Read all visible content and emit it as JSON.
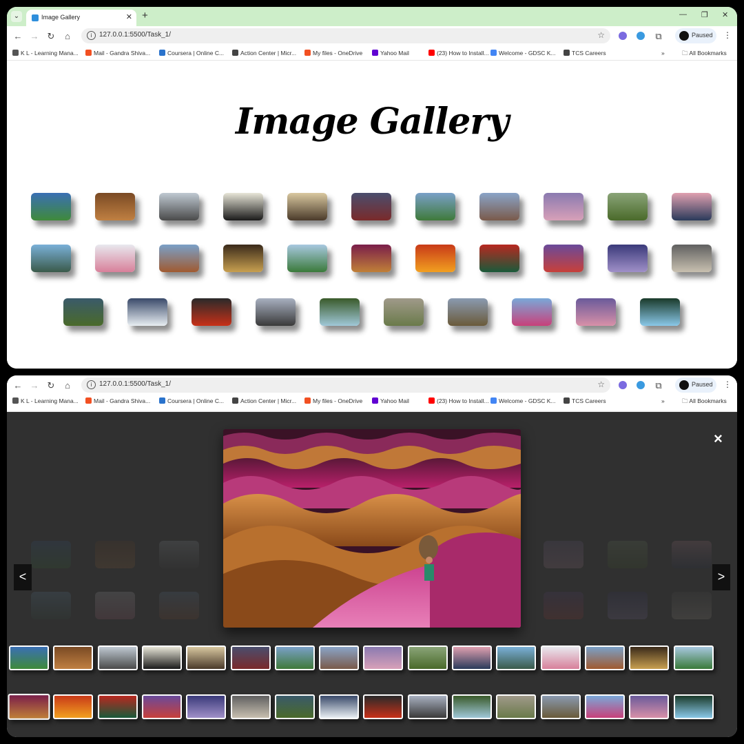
{
  "browser": {
    "tab_title": "Image Gallery",
    "url": "127.0.0.1:5500/Task_1/",
    "profile_label": "Paused",
    "all_bookmarks_label": "All Bookmarks",
    "overflow_label": "»"
  },
  "bookmarks": [
    {
      "label": "K L - Learning Mana...",
      "icon_color": "#555555"
    },
    {
      "label": "Mail - Gandra Shiva...",
      "icon_color": "#f25022"
    },
    {
      "label": "Coursera | Online C...",
      "icon_color": "#2a73cc"
    },
    {
      "label": "Action Center | Micr...",
      "icon_color": "#444444"
    },
    {
      "label": "My files - OneDrive",
      "icon_color": "#f25022"
    },
    {
      "label": "Yahoo Mail",
      "icon_color": "#6001d2"
    },
    {
      "label": "(23) How to Install...",
      "icon_color": "#ff0000"
    },
    {
      "label": "Welcome - GDSC K...",
      "icon_color": "#4285f4"
    },
    {
      "label": "TCS Careers",
      "icon_color": "#444444"
    }
  ],
  "gallery": {
    "title": "Image Gallery",
    "images": [
      {
        "name": "coastal-meadow",
        "colors": [
          "#3a6fb4",
          "#3f8a3a"
        ]
      },
      {
        "name": "autumn-leaves",
        "colors": [
          "#7a4a24",
          "#c08042"
        ]
      },
      {
        "name": "railway-tracks",
        "colors": [
          "#bfc9d2",
          "#4a4a4a"
        ]
      },
      {
        "name": "forest-silhouette",
        "colors": [
          "#e8e6d8",
          "#1a1a1a"
        ]
      },
      {
        "name": "rocky-sunrise",
        "colors": [
          "#d9c8a0",
          "#4a3a2a"
        ]
      },
      {
        "name": "canyon-dusk",
        "colors": [
          "#4a4e6e",
          "#7a2a2a"
        ]
      },
      {
        "name": "mountain-river",
        "colors": [
          "#7aa0c8",
          "#3f7a3a"
        ]
      },
      {
        "name": "rocky-shore",
        "colors": [
          "#8aa4c8",
          "#7a5a4a"
        ]
      },
      {
        "name": "pink-lake",
        "colors": [
          "#8a7ab0",
          "#d8a0b8"
        ]
      },
      {
        "name": "green-valley",
        "colors": [
          "#8aa478",
          "#4a6a2a"
        ]
      },
      {
        "name": "mountain-sunset",
        "colors": [
          "#e0a0b0",
          "#2a3a5a"
        ]
      },
      {
        "name": "alpine-reflection",
        "colors": [
          "#7ab0d8",
          "#3a5a4a"
        ]
      },
      {
        "name": "pink-salt-flats",
        "colors": [
          "#e8e8ee",
          "#d8809a"
        ]
      },
      {
        "name": "red-rocks",
        "colors": [
          "#7aa0c8",
          "#a05a30"
        ]
      },
      {
        "name": "forest-sunburst",
        "colors": [
          "#3a2a1a",
          "#c8a050"
        ]
      },
      {
        "name": "river-forest",
        "colors": [
          "#a8c8e0",
          "#3a7a3a"
        ]
      },
      {
        "name": "purple-tunnels",
        "colors": [
          "#7a1e4a",
          "#c08038"
        ]
      },
      {
        "name": "desert-sunset",
        "colors": [
          "#c83a18",
          "#f2a020"
        ]
      },
      {
        "name": "red-lake",
        "colors": [
          "#b82820",
          "#1a5a3a"
        ]
      },
      {
        "name": "purple-tree",
        "colors": [
          "#6a4a9a",
          "#c8403a"
        ]
      },
      {
        "name": "planet-night",
        "colors": [
          "#3a3a7a",
          "#a090c8"
        ]
      },
      {
        "name": "smoke-cloud",
        "colors": [
          "#606060",
          "#c8c0b0"
        ]
      },
      {
        "name": "rainbow-field",
        "colors": [
          "#3a5a6a",
          "#4a6a2a"
        ]
      },
      {
        "name": "snow-road",
        "colors": [
          "#3a4a6a",
          "#e8eef2"
        ]
      },
      {
        "name": "red-eclipse",
        "colors": [
          "#2a2a2a",
          "#c83018"
        ]
      },
      {
        "name": "desert-road",
        "colors": [
          "#a8b0c0",
          "#3a3a3a"
        ]
      },
      {
        "name": "jungle-cascade",
        "colors": [
          "#3a5a2a",
          "#a0c8d8"
        ]
      },
      {
        "name": "winding-path",
        "colors": [
          "#a09a8a",
          "#6a7a4a"
        ]
      },
      {
        "name": "sunset-field",
        "colors": [
          "#8a9ab0",
          "#6a5a3a"
        ]
      },
      {
        "name": "flower-meadow",
        "colors": [
          "#7aa8d8",
          "#c8407a"
        ]
      },
      {
        "name": "lavender-horizon",
        "colors": [
          "#6a5a9a",
          "#d890a8"
        ]
      },
      {
        "name": "blue-waterfall",
        "colors": [
          "#1a3a2a",
          "#8ac8e8"
        ]
      }
    ]
  },
  "lightbox": {
    "close_label": "×",
    "prev_label": "<",
    "next_label": ">",
    "current_image": "purple-tunnels",
    "selected_index": 16
  }
}
